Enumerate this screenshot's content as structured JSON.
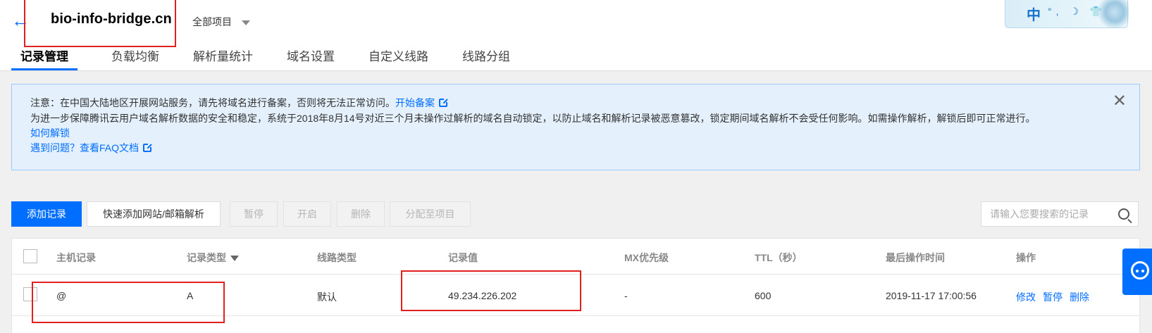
{
  "header": {
    "back_icon": "arrow-left-icon",
    "domain": "bio-info-bridge.cn",
    "project_selector": "全部项目",
    "badge": {
      "char": "中",
      "icons": "°, ☽ 👕"
    }
  },
  "tabs": [
    {
      "label": "记录管理",
      "active": true
    },
    {
      "label": "负载均衡"
    },
    {
      "label": "解析量统计"
    },
    {
      "label": "域名设置"
    },
    {
      "label": "自定义线路"
    },
    {
      "label": "线路分组"
    }
  ],
  "notice": {
    "line1_text": "注意：在中国大陆地区开展网站服务，请先将域名进行备案，否则将无法正常访问。",
    "line1_link": "开始备案",
    "line2_text": "为进一步保障腾讯云用户域名解析数据的安全和稳定，系统于2018年8月14号对近三个月未操作过解析的域名自动锁定，以防止域名和解析记录被恶意篡改，锁定期间域名解析不会受任何影响。如需操作解析，解锁后即可正常进行。",
    "line3_link": "如何解锁",
    "line4_text": "遇到问题？",
    "line4_link": "查看FAQ文档"
  },
  "toolbar": {
    "add": "添加记录",
    "quick_add": "快速添加网站/邮箱解析",
    "pause": "暂停",
    "enable": "开启",
    "delete": "删除",
    "assign": "分配至项目",
    "search_placeholder": "请输入您要搜索的记录"
  },
  "table": {
    "headers": {
      "host": "主机记录",
      "type": "记录类型",
      "line": "线路类型",
      "value": "记录值",
      "mx": "MX优先级",
      "ttl": "TTL（秒）",
      "time": "最后操作时间",
      "ops": "操作"
    },
    "rows": [
      {
        "host": "@",
        "type": "A",
        "line": "默认",
        "value": "49.234.226.202",
        "mx": "-",
        "ttl": "600",
        "time": "2019-11-17 17:00:56",
        "op_edit": "修改",
        "op_pause": "暂停",
        "op_delete": "删除"
      }
    ]
  },
  "colors": {
    "accent": "#006eff",
    "annotation_red": "#e0201e",
    "notice_bg": "#e4f0fc"
  }
}
